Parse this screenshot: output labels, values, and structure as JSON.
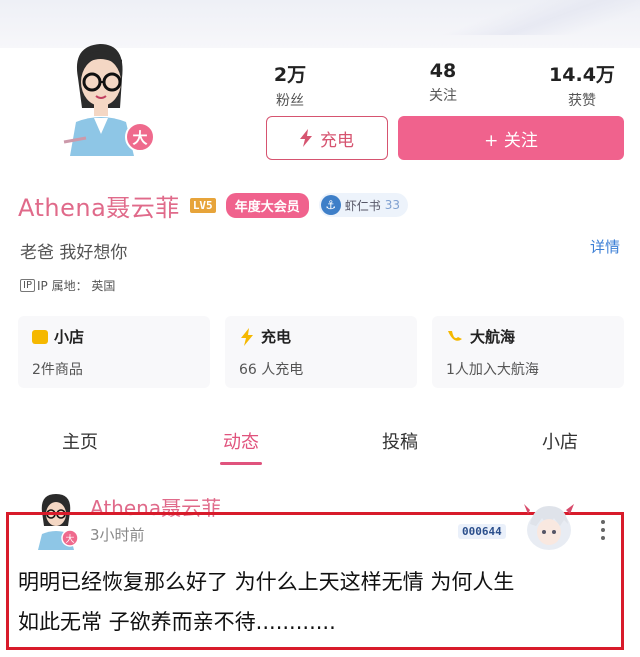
{
  "profile": {
    "name": "Athena聂云菲",
    "level_tag": "LV5",
    "vip_tag": "年度大会员",
    "badge_char": "大",
    "shrimp_label": "虾仁书",
    "shrimp_count": "33",
    "signature": "老爸 我好想你",
    "detail_link": "详情",
    "ip_icon": "IP",
    "ip_text": "IP 属地： 英国"
  },
  "stats": [
    {
      "value": "2万",
      "label": "粉丝"
    },
    {
      "value": "48",
      "label": "关注"
    },
    {
      "value": "14.4万",
      "label": "获赞"
    }
  ],
  "buttons": {
    "charge": "充电",
    "follow": "+ 关注"
  },
  "cards": [
    {
      "title": "小店",
      "sub": "2件商品",
      "icon": "shop-icon"
    },
    {
      "title": "充电",
      "sub": "66 人充电",
      "icon": "bolt-icon"
    },
    {
      "title": "大航海",
      "sub": "1人加入大航海",
      "icon": "ship-icon"
    }
  ],
  "tabs": [
    {
      "label": "主页"
    },
    {
      "label": "动态"
    },
    {
      "label": "投稿"
    },
    {
      "label": "小店"
    }
  ],
  "post": {
    "author": "Athena聂云菲",
    "time": "3小时前",
    "fan_number": "000644",
    "text_line1": "明明已经恢复那么好了 为什么上天这样无情 为何人生",
    "text_line2": "如此无常 子欲养而亲不待............"
  },
  "colors": {
    "accent_pink": "#f0628d",
    "name_pink": "#e06a8a",
    "link_blue": "#3c7fd6",
    "highlight_red": "#d81b2a"
  }
}
